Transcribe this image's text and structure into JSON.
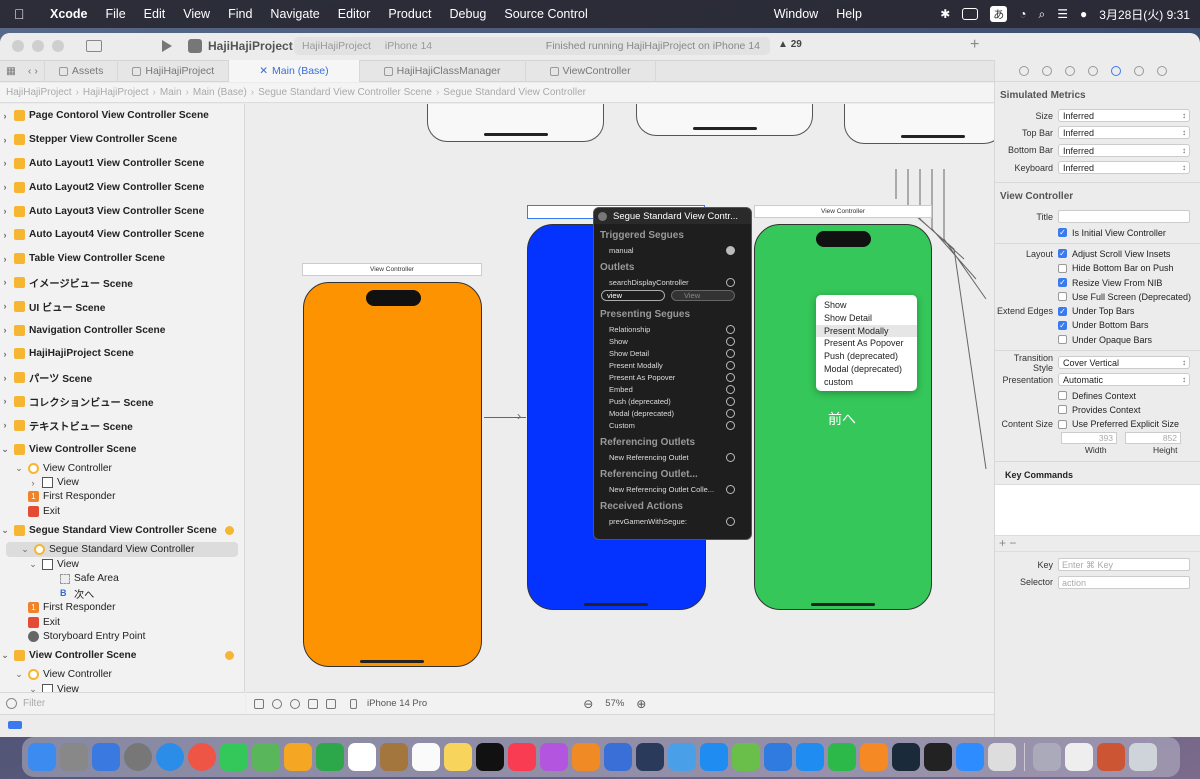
{
  "menubar": {
    "app": "Xcode",
    "items": [
      "File",
      "Edit",
      "View",
      "Find",
      "Navigate",
      "Editor",
      "Product",
      "Debug",
      "Source Control",
      "Window",
      "Help"
    ],
    "input_mode": "あ",
    "datetime": "3月28日(火)  9:31"
  },
  "toolbar": {
    "project": "HajiHajiProject",
    "scheme": "HajiHajiProject",
    "device": "iPhone 14",
    "status": "Finished running HajiHajiProject on iPhone 14",
    "warnings": "29"
  },
  "tabs": [
    "Assets",
    "HajiHajiProject",
    "Main (Base)",
    "HajiHajiClassManager",
    "ViewController"
  ],
  "active_tab": "Main (Base)",
  "jumpbar": [
    "HajiHajiProject",
    "HajiHajiProject",
    "Main",
    "Main (Base)",
    "Segue Standard View Controller Scene",
    "Segue Standard View Controller"
  ],
  "navigator": {
    "scenes": [
      "Page Contorol View Controller Scene",
      "Stepper View Controller Scene",
      "Auto Layout1 View Controller Scene",
      "Auto Layout2 View Controller Scene",
      "Auto Layout3 View Controller Scene",
      "Auto Layout4 View Controller Scene",
      "Table View Controller Scene",
      "イメージビュー Scene",
      "UI ビュー Scene",
      "Navigation Controller Scene",
      "HajiHajiProject Scene",
      "パーツ Scene",
      "コレクションビュー Scene",
      "テキストビュー Scene"
    ],
    "vc_scene1": {
      "title": "View Controller Scene",
      "vc": "View Controller",
      "view": "View",
      "fr": "First Responder",
      "exit": "Exit"
    },
    "segue_scene": {
      "title": "Segue Standard View Controller Scene",
      "vc": "Segue Standard View Controller",
      "view": "View",
      "safe": "Safe Area",
      "button": "次へ",
      "fr": "First Responder",
      "exit": "Exit",
      "entry": "Storyboard Entry Point"
    },
    "vc_scene2": {
      "title": "View Controller Scene",
      "vc": "View Controller",
      "view": "View"
    },
    "filter_placeholder": "Filter"
  },
  "canvas": {
    "vc_label_left": "View Controller",
    "vc_label_right": "View Controller",
    "green_text": "前へ",
    "device": "iPhone 14 Pro",
    "zoom": "57%",
    "colors": {
      "orange": "#fd9300",
      "blue": "#0433ff",
      "green": "#35c759"
    }
  },
  "connections": {
    "title": "Segue Standard View Contr...",
    "triggered_header": "Triggered Segues",
    "triggered": [
      "manual"
    ],
    "outlets_header": "Outlets",
    "outlets": [
      "searchDisplayController"
    ],
    "view_outlet": "view",
    "view_target": "View",
    "presenting_header": "Presenting Segues",
    "presenting": [
      "Relationship",
      "Show",
      "Show Detail",
      "Present Modally",
      "Present As Popover",
      "Embed",
      "Push (deprecated)",
      "Modal (deprecated)",
      "Custom"
    ],
    "ref_outlets_header": "Referencing Outlets",
    "ref_outlets": [
      "New Referencing Outlet"
    ],
    "ref_coll_header": "Referencing Outlet...",
    "ref_coll": [
      "New Referencing Outlet Colle..."
    ],
    "actions_header": "Received Actions",
    "actions": [
      "prevGamenWithSegue:"
    ]
  },
  "segue_menu": {
    "items": [
      "Show",
      "Show Detail",
      "Present Modally",
      "Present As Popover",
      "Push (deprecated)",
      "Modal (deprecated)",
      "custom"
    ],
    "highlighted": "Present Modally"
  },
  "inspector": {
    "simulated_header": "Simulated Metrics",
    "size_label": "Size",
    "size": "Inferred",
    "topbar_label": "Top Bar",
    "topbar": "Inferred",
    "bottombar_label": "Bottom Bar",
    "bottombar": "Inferred",
    "keyboard_label": "Keyboard",
    "keyboard": "Inferred",
    "vc_header": "View Controller",
    "title_label": "Title",
    "initial": "Is Initial View Controller",
    "layout_label": "Layout",
    "adjust": "Adjust Scroll View Insets",
    "hide_bottom": "Hide Bottom Bar on Push",
    "resize": "Resize View From NIB",
    "fullscreen": "Use Full Screen (Deprecated)",
    "extend_label": "Extend Edges",
    "under_top": "Under Top Bars",
    "under_bottom": "Under Bottom Bars",
    "under_opaque": "Under Opaque Bars",
    "transition_label": "Transition Style",
    "transition": "Cover Vertical",
    "presentation_label": "Presentation",
    "presentation": "Automatic",
    "defines": "Defines Context",
    "provides": "Provides Context",
    "content_label": "Content Size",
    "preferred": "Use Preferred Explicit Size",
    "width_val": "393",
    "height_val": "852",
    "width_label": "Width",
    "height_label": "Height",
    "keycmd_header": "Key Commands",
    "key_label": "Key",
    "key_placeholder": "Enter ⌘ Key",
    "selector_label": "Selector",
    "selector_placeholder": "action"
  }
}
